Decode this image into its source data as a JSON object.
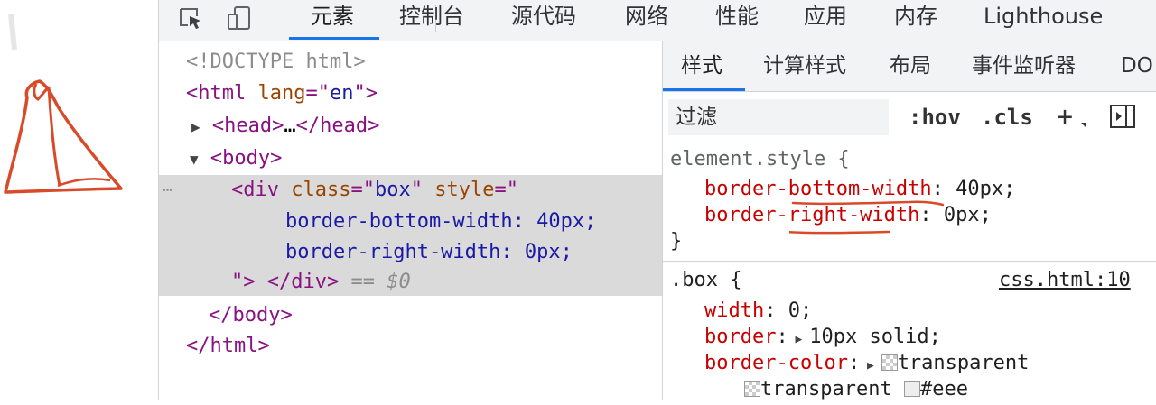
{
  "toolbar": {
    "tabs": [
      "元素",
      "控制台",
      "源代码",
      "网络",
      "性能",
      "应用",
      "内存",
      "Lighthouse"
    ],
    "active_tab": "元素"
  },
  "elements": {
    "doctype": "<!DOCTYPE html>",
    "html_open_tag": "html",
    "lang_attr": "lang",
    "lang_value": "en",
    "head_collapsed": "head",
    "ellipsis": "…",
    "body_tag": "body",
    "div_tag": "div",
    "class_attr": "class",
    "class_value": "box",
    "style_attr": "style",
    "style_line1": "border-bottom-width: 40px;",
    "style_line2": "border-right-width: 0px;",
    "selected_marker": "== $0",
    "row_dots": "⋯"
  },
  "styles": {
    "subtabs": [
      "样式",
      "计算样式",
      "布局",
      "事件监听器",
      "DO"
    ],
    "filter_placeholder": "过滤",
    "hov_label": ":hov",
    "cls_label": ".cls",
    "add_label": "+",
    "element_style_selector": "element.style {",
    "element_style_rules": [
      {
        "prop": "border-bottom-width",
        "value": "40px"
      },
      {
        "prop": "border-right-width",
        "value": "0px"
      }
    ],
    "close_brace": "}",
    "box_selector": ".box {",
    "box_source": "css.html:10",
    "box_rules": [
      {
        "prop": "width",
        "value": "0"
      },
      {
        "prop": "border",
        "value": "10px solid"
      },
      {
        "prop": "border-color",
        "value": "transparent"
      }
    ],
    "border_color_cont": [
      "transparent",
      "#eee"
    ]
  },
  "colors": {
    "accent": "#1a73e8",
    "annotation": "#d94a2a",
    "css_property": "#c80000"
  }
}
